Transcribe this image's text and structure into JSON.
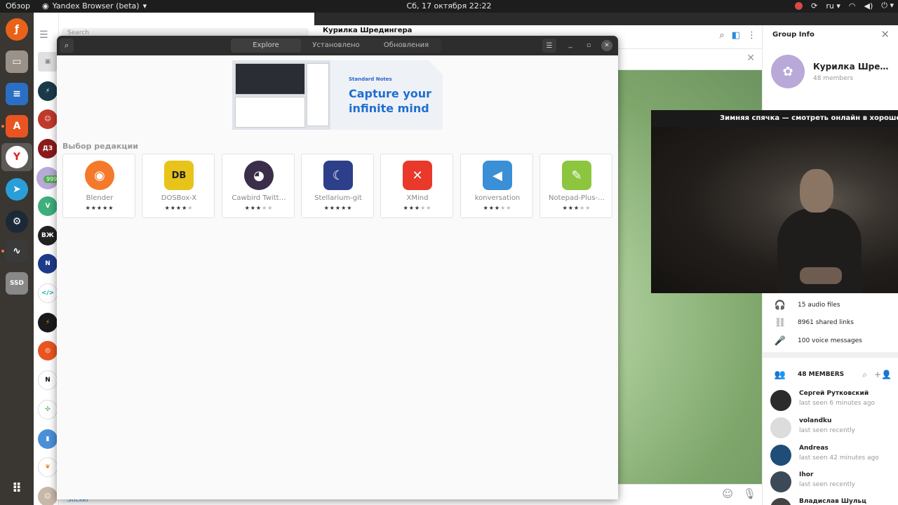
{
  "topbar": {
    "overview": "Обзор",
    "app": "Yandex Browser (beta)",
    "clock": "Сб, 17 октября  22:22",
    "lang": "ru"
  },
  "dock": {
    "items": [
      {
        "name": "firefox-icon",
        "color": "#e8621a"
      },
      {
        "name": "files-icon",
        "color": "#9a9289"
      },
      {
        "name": "writer-icon",
        "color": "#2a6fc4"
      },
      {
        "name": "software-icon",
        "color": "#e95420"
      },
      {
        "name": "yandex-browser-icon",
        "color": "#ffffff"
      },
      {
        "name": "telegram-icon",
        "color": "#2a9ed8"
      },
      {
        "name": "steam-icon",
        "color": "#1b2838"
      },
      {
        "name": "system-monitor-icon",
        "color": "#3a3a3a"
      },
      {
        "name": "ssd-drive-icon",
        "color": "#888888"
      },
      {
        "name": "apps-grid-icon",
        "color": "#3a3631"
      }
    ],
    "ssd_label": "SSD"
  },
  "telegram": {
    "unread": "9999",
    "search_placeholder": "Search",
    "bottom_hint": "Sticker",
    "chat_title": "Курилка Шредингера",
    "info": {
      "title": "Group Info",
      "group_name": "Курилка Шредингера",
      "members_count": "48 members",
      "media": [
        {
          "icon": "headphones-icon",
          "label": "15 audio files"
        },
        {
          "icon": "link-icon",
          "label": "8961 shared links"
        },
        {
          "icon": "microphone-icon",
          "label": "100 voice messages"
        }
      ],
      "members_header": "48 MEMBERS",
      "members": [
        {
          "name": "Сергей Рутковский",
          "status": "last seen 6 minutes ago",
          "color": "#2b2b2b"
        },
        {
          "name": "volandku",
          "status": "last seen recently",
          "color": "#dcdcdc"
        },
        {
          "name": "Andreas",
          "status": "last seen 42 minutes ago",
          "color": "#1e4e78"
        },
        {
          "name": "Ihor",
          "status": "last seen recently",
          "color": "#3c4a57"
        },
        {
          "name": "Владислав Шульц",
          "status": "",
          "color": "#444444"
        }
      ]
    }
  },
  "video": {
    "title": "Зимняя спячка — смотреть онлайн в хорошем качестве"
  },
  "software": {
    "tabs": [
      "Explore",
      "Установлено",
      "Обновления"
    ],
    "active_tab": 0,
    "banner": {
      "brand": "Standard Notes",
      "tagline": "Capture your infinite mind"
    },
    "section_title": "Выбор редакции",
    "apps": [
      {
        "name": "Blender",
        "rating": 5,
        "color": "#f5792a",
        "glyph": "◉"
      },
      {
        "name": "DOSBox-X",
        "rating": 4,
        "color": "#e8c31a",
        "glyph": "DB"
      },
      {
        "name": "Cawbird Twitt…",
        "rating": 3,
        "color": "#3a2e4a",
        "glyph": "◕"
      },
      {
        "name": "Stellarium-git",
        "rating": 5,
        "color": "#2d3f8a",
        "glyph": "☾"
      },
      {
        "name": "XMind",
        "rating": 3,
        "color": "#e8392b",
        "glyph": "✕"
      },
      {
        "name": "konversation",
        "rating": 3,
        "color": "#3a8fd6",
        "glyph": "◀"
      },
      {
        "name": "Notepad-Plus-…",
        "rating": 3,
        "color": "#8cc63f",
        "glyph": "✎"
      }
    ]
  }
}
